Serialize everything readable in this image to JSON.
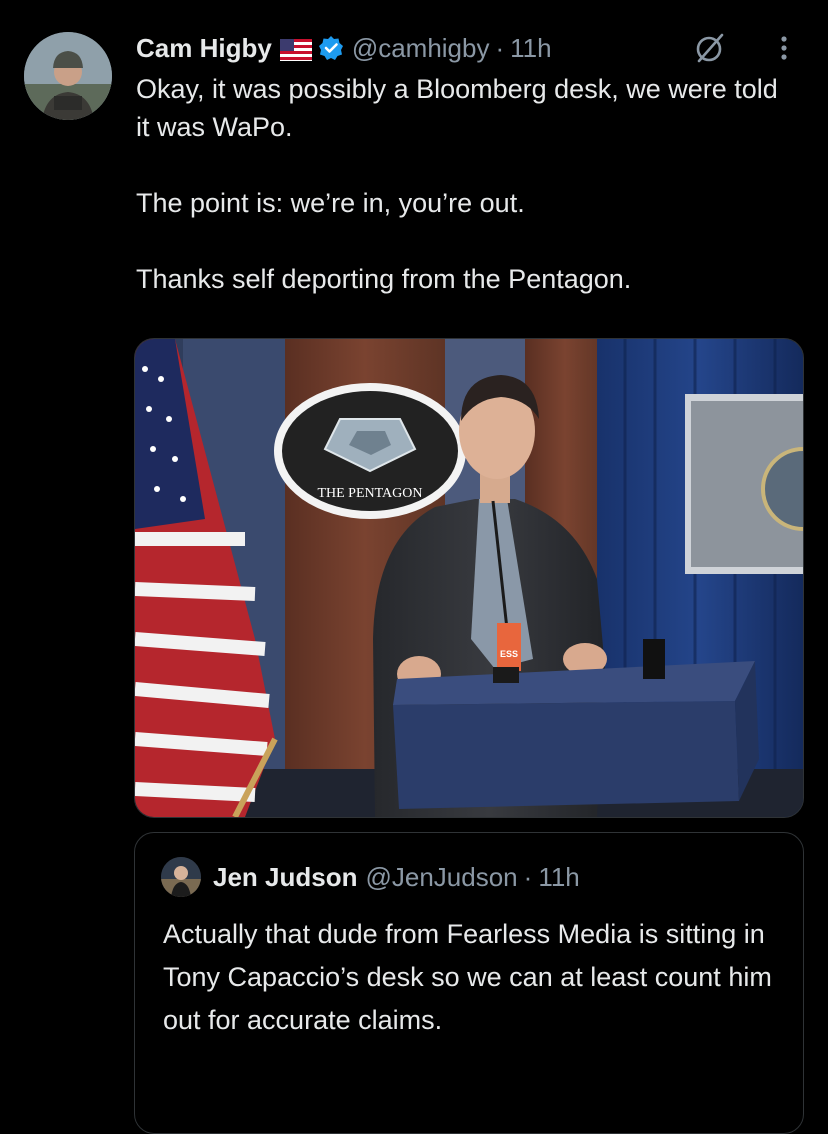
{
  "tweet": {
    "author_name": "Cam Higby",
    "handle": "@camhigby",
    "separator": "·",
    "time": "11h",
    "flag_icon": "us-flag-icon",
    "verified_icon": "verified-badge-icon",
    "paragraphs": [
      "Okay, it was possibly a Bloomberg desk, we were told it was WaPo.",
      "The point is: we’re in, you’re out.",
      "Thanks self deporting from the Pentagon."
    ],
    "media": {
      "seal_text": "THE PENTAGON",
      "lanyard_text": "ESS"
    }
  },
  "quoted": {
    "author_name": "Jen Judson",
    "handle": "@JenJudson",
    "separator": "·",
    "time": "11h",
    "text": "Actually that dude from Fearless Media is sitting in Tony Capaccio’s desk so we can at least count him out for accurate claims."
  },
  "colors": {
    "background": "#000000",
    "text": "#e7e9ea",
    "secondary": "#8b98a5",
    "verified": "#1d9bf0",
    "border": "#2f3336"
  }
}
